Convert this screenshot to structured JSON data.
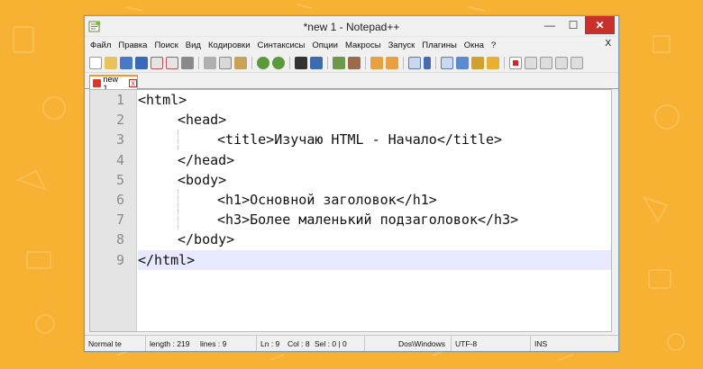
{
  "window": {
    "title": "*new 1 - Notepad++",
    "controls": {
      "minimize": "—",
      "maximize": "☐",
      "close": "✕"
    }
  },
  "menu": {
    "items": [
      "Файл",
      "Правка",
      "Поиск",
      "Вид",
      "Кодировки",
      "Синтаксисы",
      "Опции",
      "Макросы",
      "Запуск",
      "Плагины",
      "Окна",
      "?"
    ],
    "close_glyph": "X"
  },
  "toolbar": {
    "icons": [
      "new-file-icon",
      "open-icon",
      "save-icon",
      "save-all-icon",
      "close-icon",
      "close-all-icon",
      "print-icon",
      "cut-icon",
      "copy-icon",
      "paste-icon",
      "undo-icon",
      "redo-icon",
      "find-icon",
      "replace-icon",
      "zoom-in-icon",
      "zoom-out-icon",
      "sync-v-icon",
      "sync-h-icon",
      "word-wrap-icon",
      "show-all-icon",
      "indent-guide-icon",
      "doc-map-icon",
      "function-list-icon",
      "folder-icon",
      "record-macro-icon",
      "stop-macro-icon",
      "play-macro-icon",
      "run-macro-icon",
      "save-macro-icon"
    ]
  },
  "tab": {
    "label": "new 1",
    "close": "x"
  },
  "editor": {
    "lines": [
      {
        "num": "1",
        "indent": 0,
        "text": "<html>"
      },
      {
        "num": "2",
        "indent": 1,
        "text": "<head>"
      },
      {
        "num": "3",
        "indent": 2,
        "text": "<title>Изучаю HTML - Начало</title>"
      },
      {
        "num": "4",
        "indent": 1,
        "text": "</head>"
      },
      {
        "num": "5",
        "indent": 1,
        "text": "<body>"
      },
      {
        "num": "6",
        "indent": 2,
        "text": "<h1>Основной заголовок</h1>"
      },
      {
        "num": "7",
        "indent": 2,
        "text": "<h3>Более маленький подзаголовок</h3>"
      },
      {
        "num": "8",
        "indent": 1,
        "text": "</body>"
      },
      {
        "num": "9",
        "indent": 0,
        "text": "</html>"
      }
    ],
    "active_line": 9
  },
  "status": {
    "type": "Normal te",
    "length": "length : 219",
    "lines": "lines : 9",
    "ln": "Ln : 9",
    "col": "Col : 8",
    "sel": "Sel : 0 | 0",
    "eol": "Dos\\Windows",
    "encoding": "UTF-8",
    "mode": "INS"
  }
}
